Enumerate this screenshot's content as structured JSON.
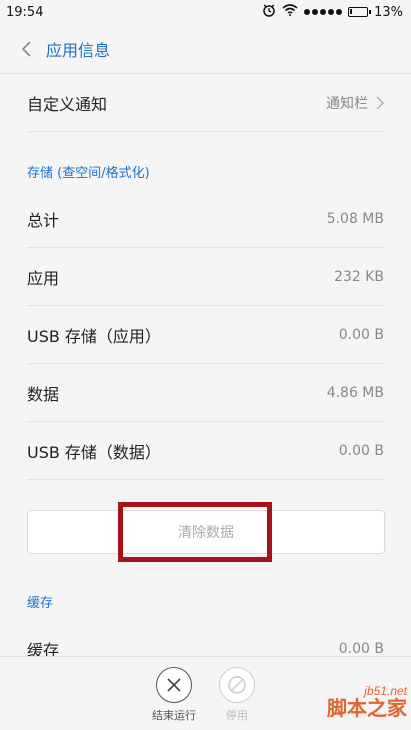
{
  "status_bar": {
    "time": "19:54",
    "battery": "13%",
    "battery_level": 0.13
  },
  "header": {
    "title": "应用信息"
  },
  "notification": {
    "label": "自定义通知",
    "value": "通知栏"
  },
  "storage_section": {
    "title": "存储 (查空间/格式化)",
    "rows": [
      {
        "label": "总计",
        "value": "5.08 MB"
      },
      {
        "label": "应用",
        "value": "232 KB"
      },
      {
        "label": "USB 存储（应用）",
        "value": "0.00 B"
      },
      {
        "label": "数据",
        "value": "4.86 MB"
      },
      {
        "label": "USB 存储（数据）",
        "value": "0.00 B"
      }
    ],
    "clear_button": "清除数据"
  },
  "cache_section": {
    "title": "缓存",
    "rows": [
      {
        "label": "缓存",
        "value": "0.00 B"
      }
    ]
  },
  "bottom_actions": {
    "force_stop": "结束运行",
    "disable": "停用"
  },
  "watermark": {
    "url": "jb51.net",
    "name": "脚本之家"
  },
  "colors": {
    "accent": "#1a73c8",
    "highlight": "#a51418",
    "watermark": "#e2642e"
  }
}
